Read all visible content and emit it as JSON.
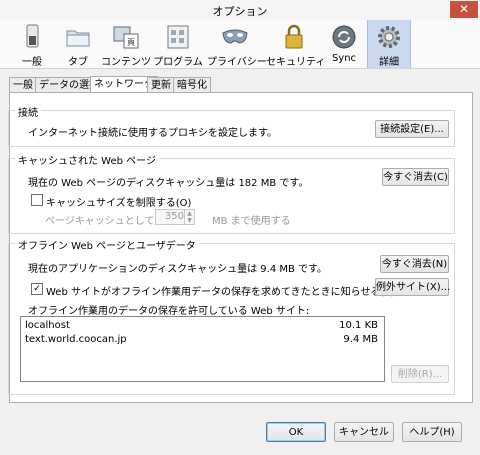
{
  "window": {
    "title": "オプション",
    "close_symbol": "✕"
  },
  "toolbar": {
    "items": [
      {
        "id": "general",
        "label": "一般",
        "icon": "switch-icon"
      },
      {
        "id": "tabs",
        "label": "タブ",
        "icon": "folder-icon"
      },
      {
        "id": "content",
        "label": "コンテンツ",
        "icon": "content-icon"
      },
      {
        "id": "applications",
        "label": "プログラム",
        "icon": "applications-icon"
      },
      {
        "id": "privacy",
        "label": "プライバシー",
        "icon": "mask-icon"
      },
      {
        "id": "security",
        "label": "セキュリティ",
        "icon": "lock-icon"
      },
      {
        "id": "sync",
        "label": "Sync",
        "icon": "sync-icon"
      },
      {
        "id": "advanced",
        "label": "詳細",
        "icon": "gear-icon",
        "active": true
      }
    ]
  },
  "tabs": [
    {
      "label": "一般"
    },
    {
      "label": "データの選択"
    },
    {
      "label": "ネットワーク",
      "active": true
    },
    {
      "label": "更新"
    },
    {
      "label": "暗号化"
    }
  ],
  "connection": {
    "title": "接続",
    "description": "インターネット接続に使用するプロキシを設定します。",
    "button": "接続設定(E)..."
  },
  "cache": {
    "title": "キャッシュされた Web ページ",
    "status": "現在の Web ページのディスクキャッシュ量は 182 MB です。",
    "clear_button": "今すぐ消去(C)",
    "limit_checkbox": "キャッシュサイズを制限する(O)",
    "limit_checked": false,
    "page_cache_label": "ページキャッシュとして (L)",
    "page_cache_value": "350",
    "page_cache_suffix": "MB まで使用する"
  },
  "offline": {
    "title": "オフライン Web ページとユーザデータ",
    "status": "現在のアプリケーションのディスクキャッシュ量は 9.4 MB です。",
    "clear_button": "今すぐ消去(N)",
    "notify_checkbox": "Web サイトがオフライン作業用データの保存を求めてきたときに知らせる(T)",
    "notify_checked": true,
    "check_mark": "✓",
    "exceptions_button": "例外サイト(X)...",
    "list_label": "オフライン作業用のデータの保存を許可している Web サイト:",
    "sites": [
      {
        "host": "localhost",
        "size": "10.1 KB"
      },
      {
        "host": "text.world.coocan.jp",
        "size": "9.4 MB"
      }
    ],
    "remove_button": "削除(R)..."
  },
  "footer": {
    "ok": "OK",
    "cancel": "キャンセル",
    "help": "ヘルプ(H)"
  },
  "colors": {
    "active_tool": "#c9d9f0",
    "close_button": "#c7503f",
    "ok_border": "#3c7fb1"
  }
}
